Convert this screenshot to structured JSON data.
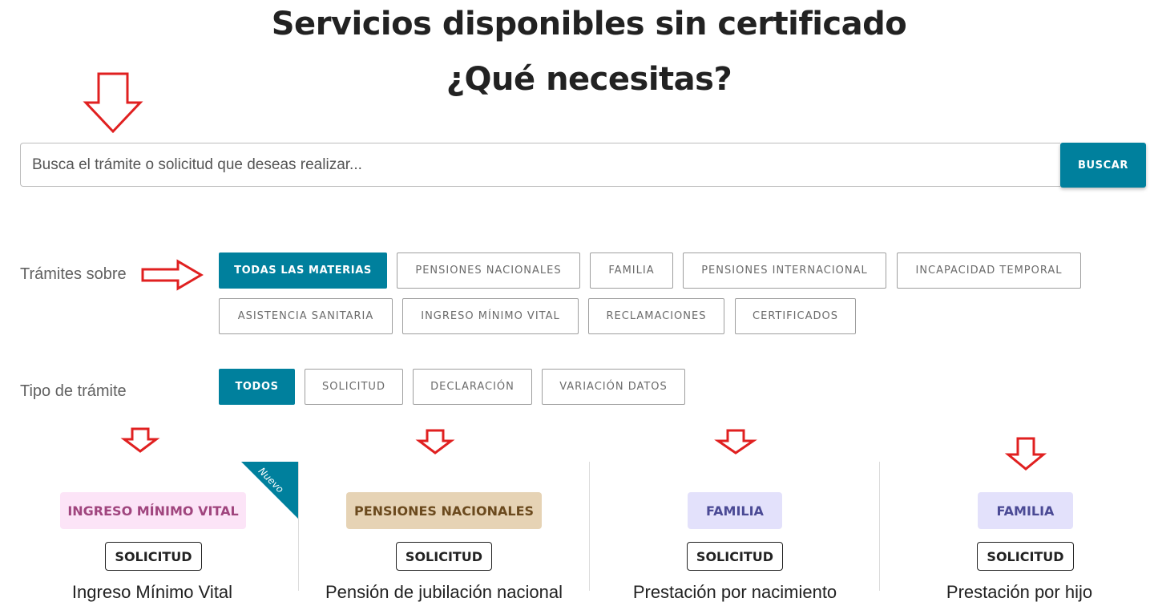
{
  "header": {
    "title": "Servicios disponibles sin certificado",
    "subtitle": "¿Qué necesitas?"
  },
  "search": {
    "placeholder": "Busca el trámite o solicitud que deseas realizar...",
    "button_label": "BUSCAR"
  },
  "filters": {
    "subject": {
      "label": "Trámites sobre",
      "options": [
        "TODAS LAS MATERIAS",
        "PENSIONES NACIONALES",
        "FAMILIA",
        "PENSIONES INTERNACIONAL",
        "INCAPACIDAD TEMPORAL",
        "ASISTENCIA SANITARIA",
        "INGRESO MÍNIMO VITAL",
        "RECLAMACIONES",
        "CERTIFICADOS"
      ],
      "selected": "TODAS LAS MATERIAS"
    },
    "type": {
      "label": "Tipo de trámite",
      "options": [
        "TODOS",
        "SOLICITUD",
        "DECLARACIÓN",
        "VARIACIÓN DATOS"
      ],
      "selected": "TODOS"
    }
  },
  "annotations": {
    "arrow_color": "#e02020"
  },
  "cards": [
    {
      "category": "INGRESO MÍNIMO VITAL",
      "category_bg": "#fce4f7",
      "category_color": "#a0457e",
      "type": "SOLICITUD",
      "title": "Ingreso Mínimo Vital",
      "ribbon": "Nuevo",
      "ribbon_color": "#00809d"
    },
    {
      "category": "PENSIONES NACIONALES",
      "category_bg": "#e6d3b5",
      "category_color": "#6b4a1e",
      "type": "SOLICITUD",
      "title": "Pensión de jubilación nacional"
    },
    {
      "category": "FAMILIA",
      "category_bg": "#e3e1fb",
      "category_color": "#4b4a95",
      "type": "SOLICITUD",
      "title": "Prestación por nacimiento"
    },
    {
      "category": "FAMILIA",
      "category_bg": "#e3e1fb",
      "category_color": "#4b4a95",
      "type": "SOLICITUD",
      "title": "Prestación por hijo"
    }
  ]
}
